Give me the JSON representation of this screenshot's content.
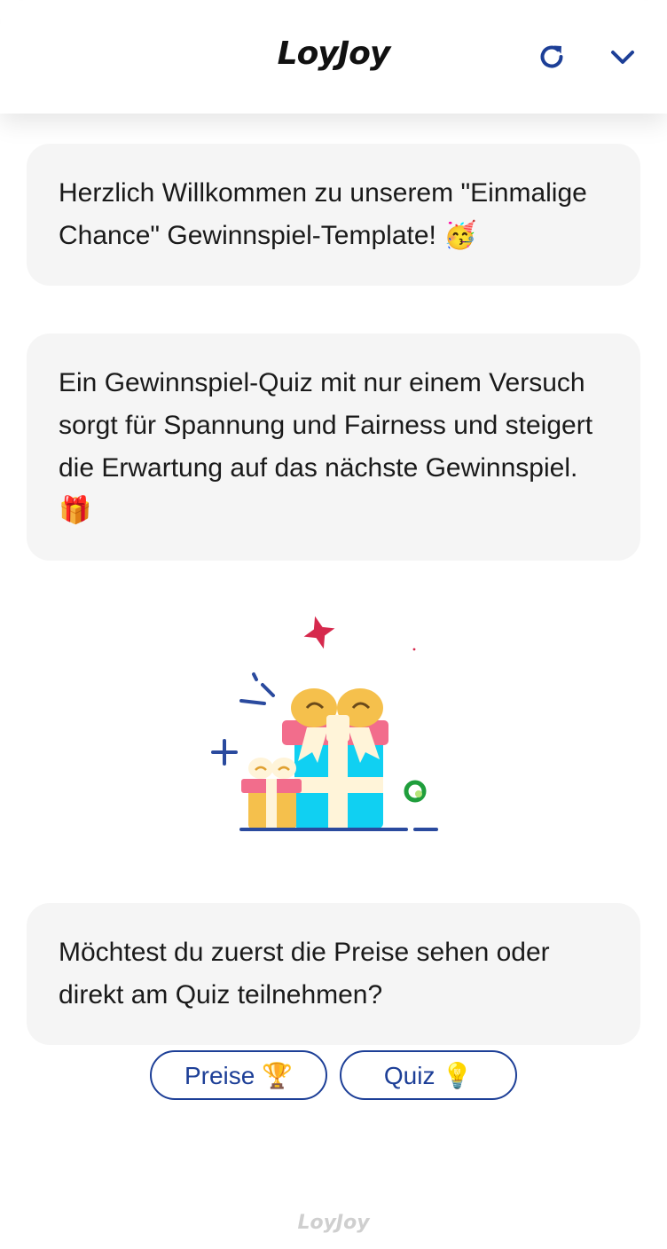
{
  "header": {
    "logo_text": "LoyJoy",
    "refresh_icon": "refresh-icon",
    "collapse_icon": "chevron-down-icon",
    "accent_color": "#1d3f97"
  },
  "messages": [
    {
      "text": "Herzlich Willkommen zu unserem \"Einmalige Chance\" Gewinnspiel-Template! 🥳"
    },
    {
      "text": "Ein Gewinnspiel-Quiz mit nur einem Versuch sorgt für Spannung und Fairness und steigert die Erwartung auf das nächste Gewinnspiel. 🎁"
    },
    {
      "text": "Möchtest du zuerst die Preise sehen oder direkt am Quiz teilnehmen?"
    }
  ],
  "illustration": {
    "icon": "gift-boxes-illustration"
  },
  "choices": [
    {
      "label": "Preise 🏆"
    },
    {
      "label": "Quiz 💡"
    }
  ],
  "footer": {
    "logo_text": "LoyJoy"
  },
  "colors": {
    "bubble_bg": "#f5f5f5",
    "button_border": "#1d3f97"
  }
}
